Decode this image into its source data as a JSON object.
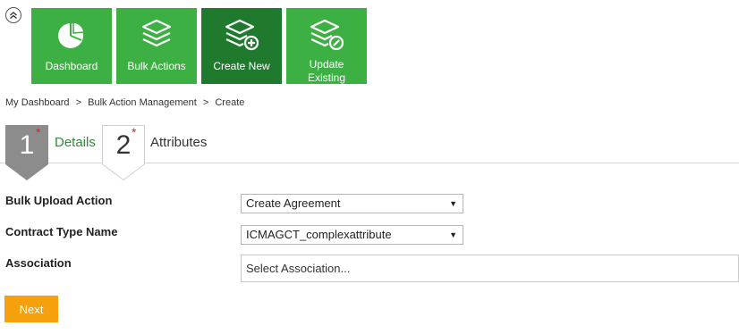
{
  "tiles": [
    {
      "label": "Dashboard",
      "icon": "pie-chart-icon"
    },
    {
      "label": "Bulk Actions",
      "icon": "layers-icon"
    },
    {
      "label": "Create New",
      "icon": "layers-add-icon"
    },
    {
      "label_line1": "Update",
      "label_line2": "Existing",
      "icon": "layers-edit-icon"
    }
  ],
  "breadcrumb": {
    "items": [
      "My Dashboard",
      "Bulk Action Management",
      "Create"
    ],
    "separator": ">"
  },
  "steps": [
    {
      "number": "1",
      "label": "Details",
      "required_mark": "*"
    },
    {
      "number": "2",
      "label": "Attributes",
      "required_mark": "*"
    }
  ],
  "form": {
    "bulk_upload_action": {
      "label": "Bulk Upload Action",
      "value": "Create Agreement"
    },
    "contract_type_name": {
      "label": "Contract Type Name",
      "value": "ICMAGCT_complexattribute"
    },
    "association": {
      "label": "Association",
      "placeholder": "Select Association..."
    }
  },
  "next_button": {
    "label": "Next"
  },
  "colors": {
    "tile": "#3cb043",
    "tile_active": "#1f7a2e",
    "step_active": "#8c8c8c",
    "step_label_active": "#2e8b3a",
    "required": "#e02020",
    "next": "#f5a00c"
  }
}
